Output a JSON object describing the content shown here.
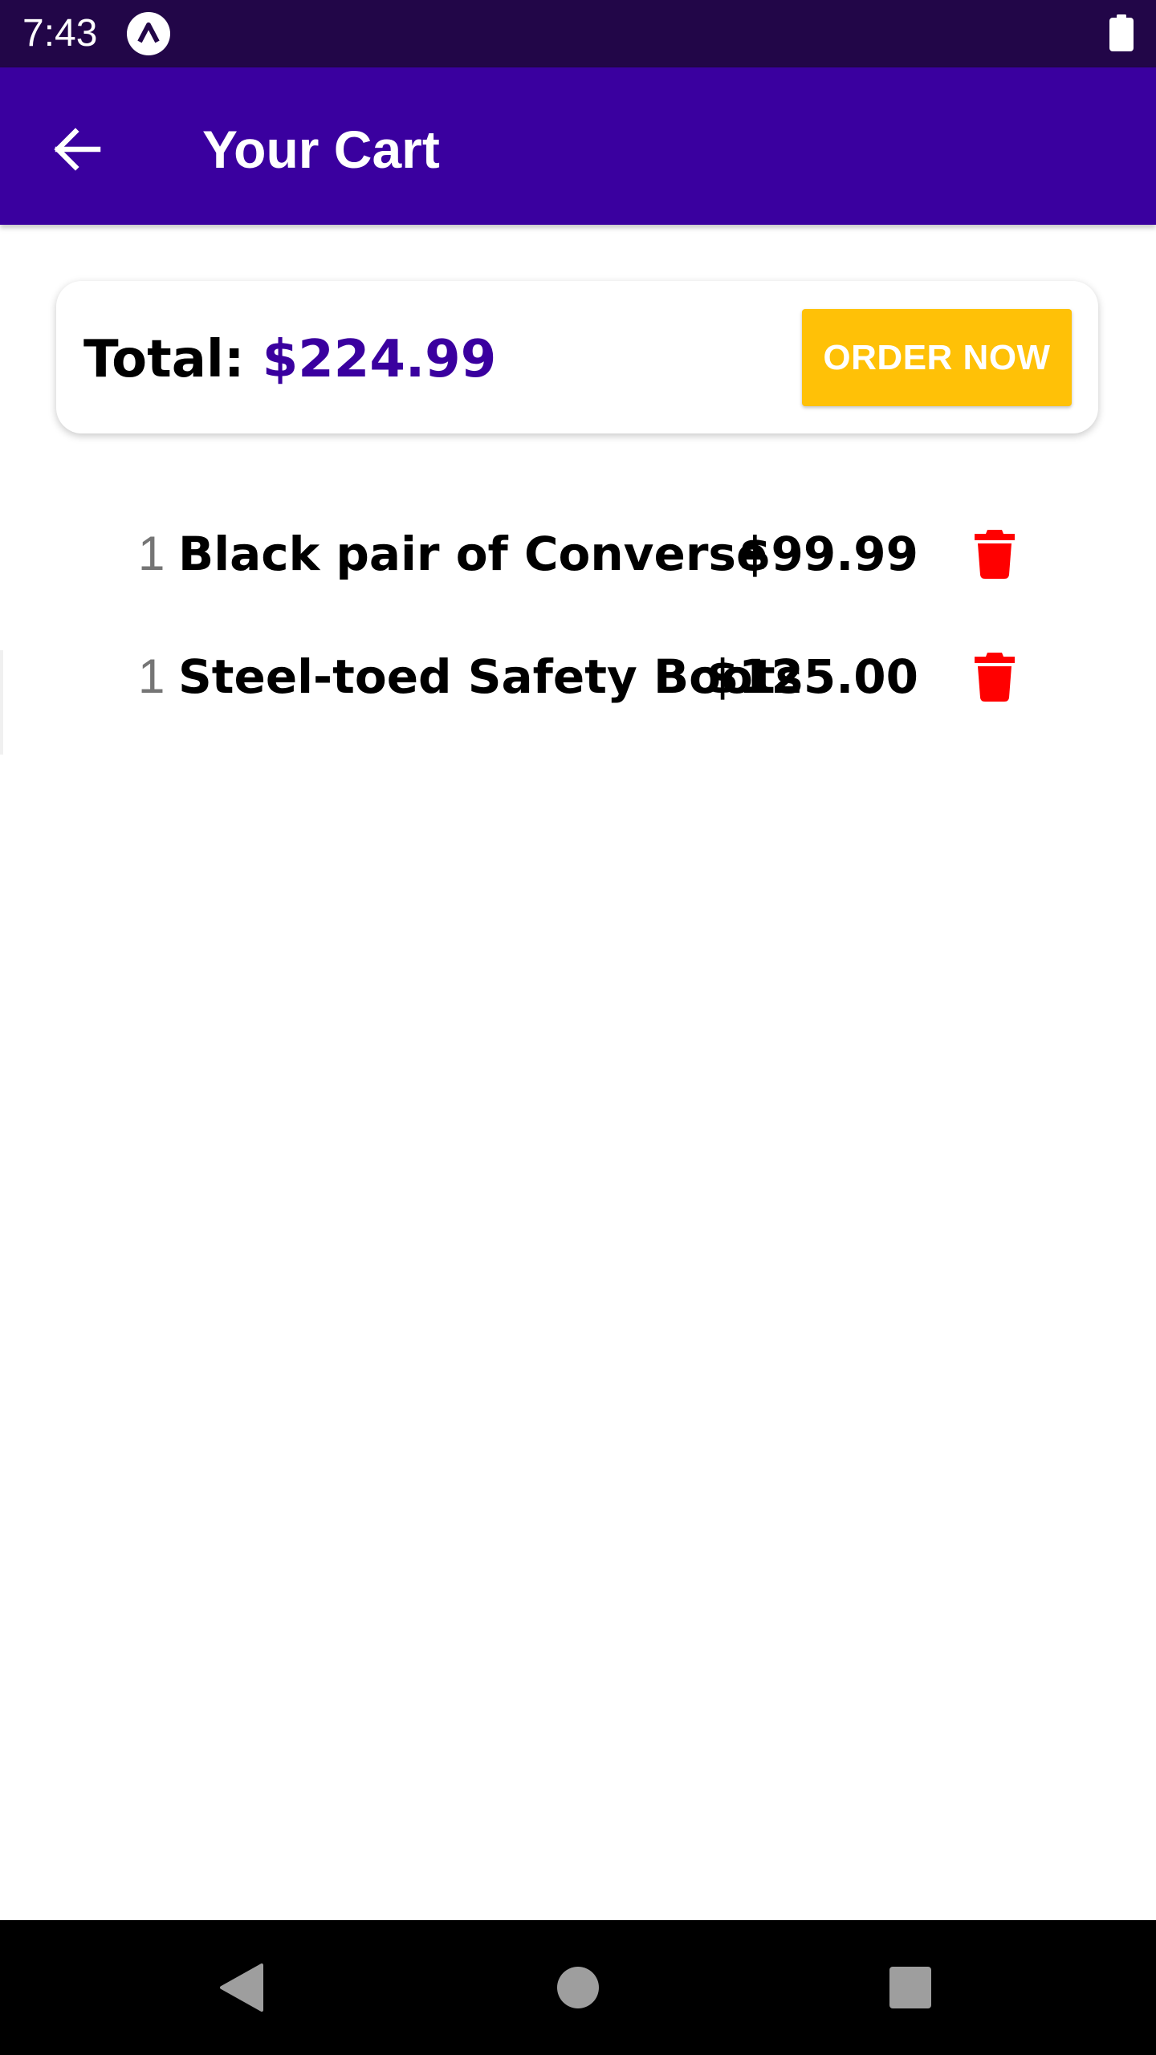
{
  "status_bar": {
    "time": "7:43",
    "app_icon": "lambda-badge-icon",
    "battery_icon": "battery-full-icon"
  },
  "app_bar": {
    "back_icon": "arrow-left-icon",
    "title": "Your Cart"
  },
  "summary": {
    "total_label": "Total: ",
    "total_amount": "$224.99",
    "order_button_label": "ORDER NOW"
  },
  "cart_items": [
    {
      "quantity": "1",
      "title": "Black pair of Converse",
      "price": "$99.99",
      "delete_icon": "trash-icon"
    },
    {
      "quantity": "1",
      "title": "Steel-toed Safety Boots",
      "price": "$125.00",
      "delete_icon": "trash-icon"
    }
  ],
  "nav_bar": {
    "back": "nav-back-icon",
    "home": "nav-home-icon",
    "recents": "nav-recents-icon"
  },
  "colors": {
    "status_bar": "#220648",
    "app_bar": "#3a009f",
    "accent": "#ffc107",
    "total_amount": "#3a009f",
    "delete": "#ff0000",
    "nav_bar": "#000000"
  }
}
